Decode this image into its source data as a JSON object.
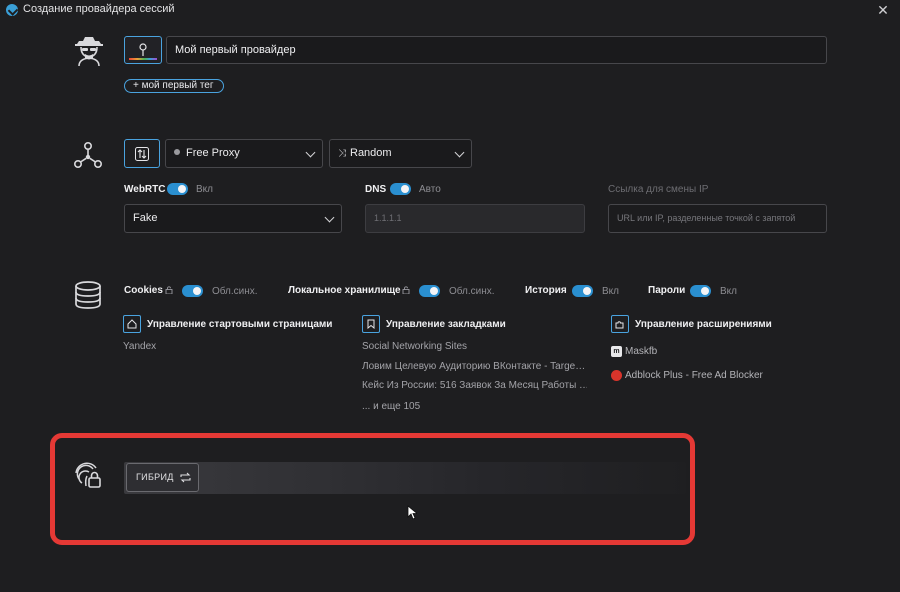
{
  "window": {
    "title": "Создание провайдера сессий"
  },
  "profile": {
    "name_value": "Мой первый провайдер",
    "tag_label": "+ мой первый тег"
  },
  "proxy": {
    "proxy_selected": "Free Proxy",
    "rotation_selected": "Random",
    "webrtc": {
      "label": "WebRTC",
      "state": "Вкл",
      "enabled": true,
      "mode_selected": "Fake"
    },
    "dns": {
      "label": "DNS",
      "state": "Авто",
      "enabled": true,
      "placeholder": "1.1.1.1"
    },
    "ip_change": {
      "label": "Ссылка для смены IP",
      "placeholder": "URL или IP, разделенные точкой с запятой"
    }
  },
  "storage": {
    "toggles": [
      {
        "label": "Cookies",
        "state": "Обл.синх.",
        "locked": true,
        "enabled": true
      },
      {
        "label": "Локальное хранилище",
        "state": "Обл.синх.",
        "locked": true,
        "enabled": true
      },
      {
        "label": "История",
        "state": "Вкл",
        "locked": false,
        "enabled": true
      },
      {
        "label": "Пароли",
        "state": "Вкл",
        "locked": false,
        "enabled": true
      }
    ],
    "start_pages": {
      "title": "Управление стартовыми страницами",
      "items": [
        "Yandex"
      ]
    },
    "bookmarks": {
      "title": "Управление закладками",
      "items": [
        "Social Networking Sites",
        "Ловим Целевую Аудиторию ВКонтакте - Targe…",
        "Кейс Из России: 516 Заявок За Месяц Работы …"
      ],
      "more": "... и еще 105"
    },
    "extensions": {
      "title": "Управление расширениями",
      "items": [
        {
          "name": "Maskfb",
          "icon": "maskfb-icon"
        },
        {
          "name": "Adblock Plus - Free Ad Blocker",
          "icon": "adblock-icon"
        }
      ]
    }
  },
  "fingerprint": {
    "mode_label": "ГИБРИД"
  },
  "colors": {
    "accent": "#2a8fd0",
    "highlight": "#e53935",
    "background": "#1e1e20"
  }
}
